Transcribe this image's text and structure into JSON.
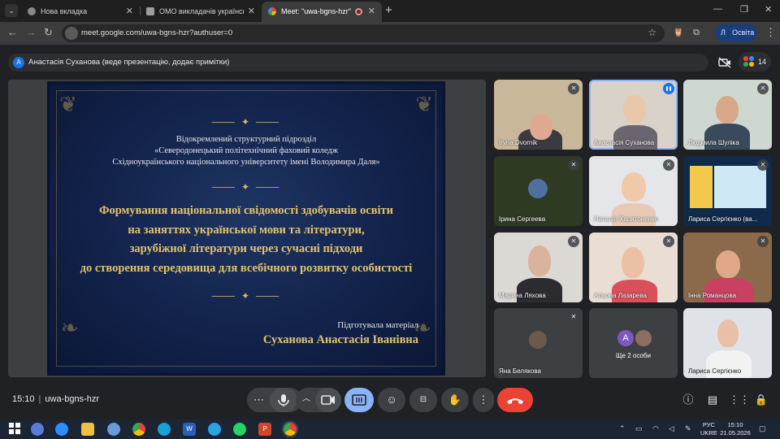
{
  "browser": {
    "tabs": [
      {
        "title": "Нова вкладка"
      },
      {
        "title": "ОМО викладачів української"
      },
      {
        "title": "Meet: \"uwa-bgns-hzr\""
      }
    ],
    "url": "meet.google.com/uwa-bgns-hzr?authuser=0",
    "profile_initial": "Л",
    "profile_name": "Освіта"
  },
  "meet": {
    "presenter_banner": "Анастасія Суханова (веде презентацію, додає примітки)",
    "presenter_initial": "А",
    "participant_count": "14",
    "time": "15:10",
    "meeting_code": "uwa-bgns-hzr",
    "slide": {
      "org_line1": "Відокремлений структурний підрозділ",
      "org_line2": "«Северодонецький політехнічний фаховий коледж",
      "org_line3": "Східноукраїнського національного університету імені Володимира Даля»",
      "title_line1": "Формування національної свідомості здобувачів освіти",
      "title_line2": "на заняттях української мови та літератури,",
      "title_line3": "зарубіжної літератури через сучасні підходи",
      "title_line4": "до створення середовища для всебічного розвитку особистості",
      "prepared_by": "Підготувала матеріал",
      "author": "Суханова Анастасія Іванівна"
    },
    "participants": [
      {
        "name": "Iryna Dvornik"
      },
      {
        "name": "Анастасія Суханова"
      },
      {
        "name": "Людмила Шуліка"
      },
      {
        "name": "Ірина Сергеева"
      },
      {
        "name": "Наталія Харитоненко"
      },
      {
        "name": "Лариса Сергієнко (ва..."
      },
      {
        "name": "Марина Ляхова"
      },
      {
        "name": "Альона Лазарева"
      },
      {
        "name": "Інна Романцова"
      },
      {
        "name": "Яна Белякова"
      },
      {
        "name": "Лариса Сергієнко"
      }
    ],
    "more_people_label": "Ще 2 особи",
    "more_people_initial": "A"
  },
  "taskbar": {
    "lang1": "РУС",
    "lang2": "UKRE",
    "time": "15:10",
    "date": "21.05.2026"
  },
  "icons": [
    "chevron-down-icon",
    "globe-icon",
    "close-icon",
    "plus-icon",
    "minimize-icon",
    "maximize-icon",
    "back-icon",
    "forward-icon",
    "reload-icon",
    "star-icon",
    "extension-icon",
    "kebab-icon",
    "camera-off-icon",
    "people-icon",
    "mic-icon",
    "mic-off-icon",
    "camera-icon",
    "present-icon",
    "emoji-icon",
    "captions-icon",
    "raise-hand-icon",
    "more-icon",
    "end-call-icon",
    "info-icon",
    "chat-icon",
    "activities-icon",
    "lock-icon",
    "windows-icon"
  ],
  "colors": {
    "accent": "#8ab4f8",
    "end_call": "#ea4335",
    "slide_gold": "#e4c36e",
    "slide_bg": "#12224a"
  }
}
